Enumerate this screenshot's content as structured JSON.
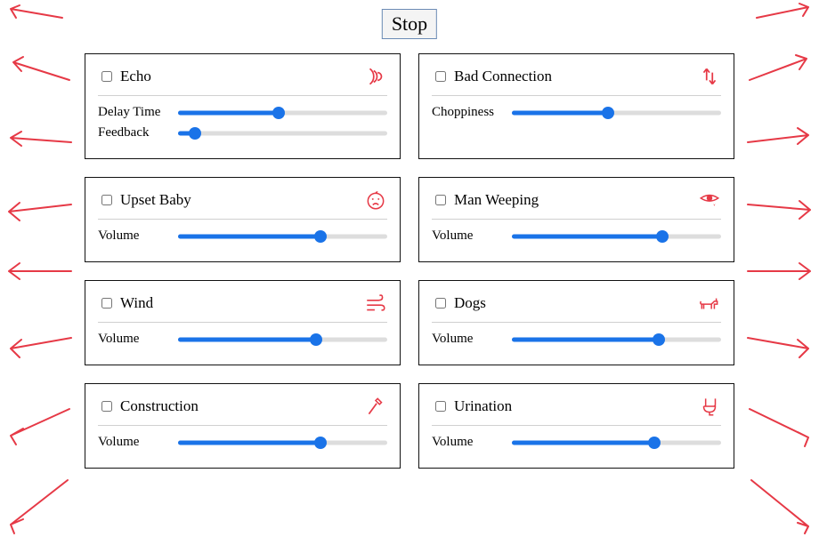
{
  "stop_label": "Stop",
  "cards": [
    {
      "title": "Echo",
      "icon": "echo-icon",
      "sliders": [
        {
          "label": "Delay Time",
          "value": 48
        },
        {
          "label": "Feedback",
          "value": 8
        }
      ]
    },
    {
      "title": "Bad Connection",
      "icon": "bad-connection-icon",
      "sliders": [
        {
          "label": "Choppiness",
          "value": 46
        }
      ]
    },
    {
      "title": "Upset Baby",
      "icon": "upset-baby-icon",
      "sliders": [
        {
          "label": "Volume",
          "value": 68
        }
      ]
    },
    {
      "title": "Man Weeping",
      "icon": "weeping-icon",
      "sliders": [
        {
          "label": "Volume",
          "value": 72
        }
      ]
    },
    {
      "title": "Wind",
      "icon": "wind-icon",
      "sliders": [
        {
          "label": "Volume",
          "value": 66
        }
      ]
    },
    {
      "title": "Dogs",
      "icon": "dog-icon",
      "sliders": [
        {
          "label": "Volume",
          "value": 70
        }
      ]
    },
    {
      "title": "Construction",
      "icon": "hammer-icon",
      "sliders": [
        {
          "label": "Volume",
          "value": 68
        }
      ]
    },
    {
      "title": "Urination",
      "icon": "toilet-icon",
      "sliders": [
        {
          "label": "Volume",
          "value": 68
        }
      ]
    }
  ]
}
